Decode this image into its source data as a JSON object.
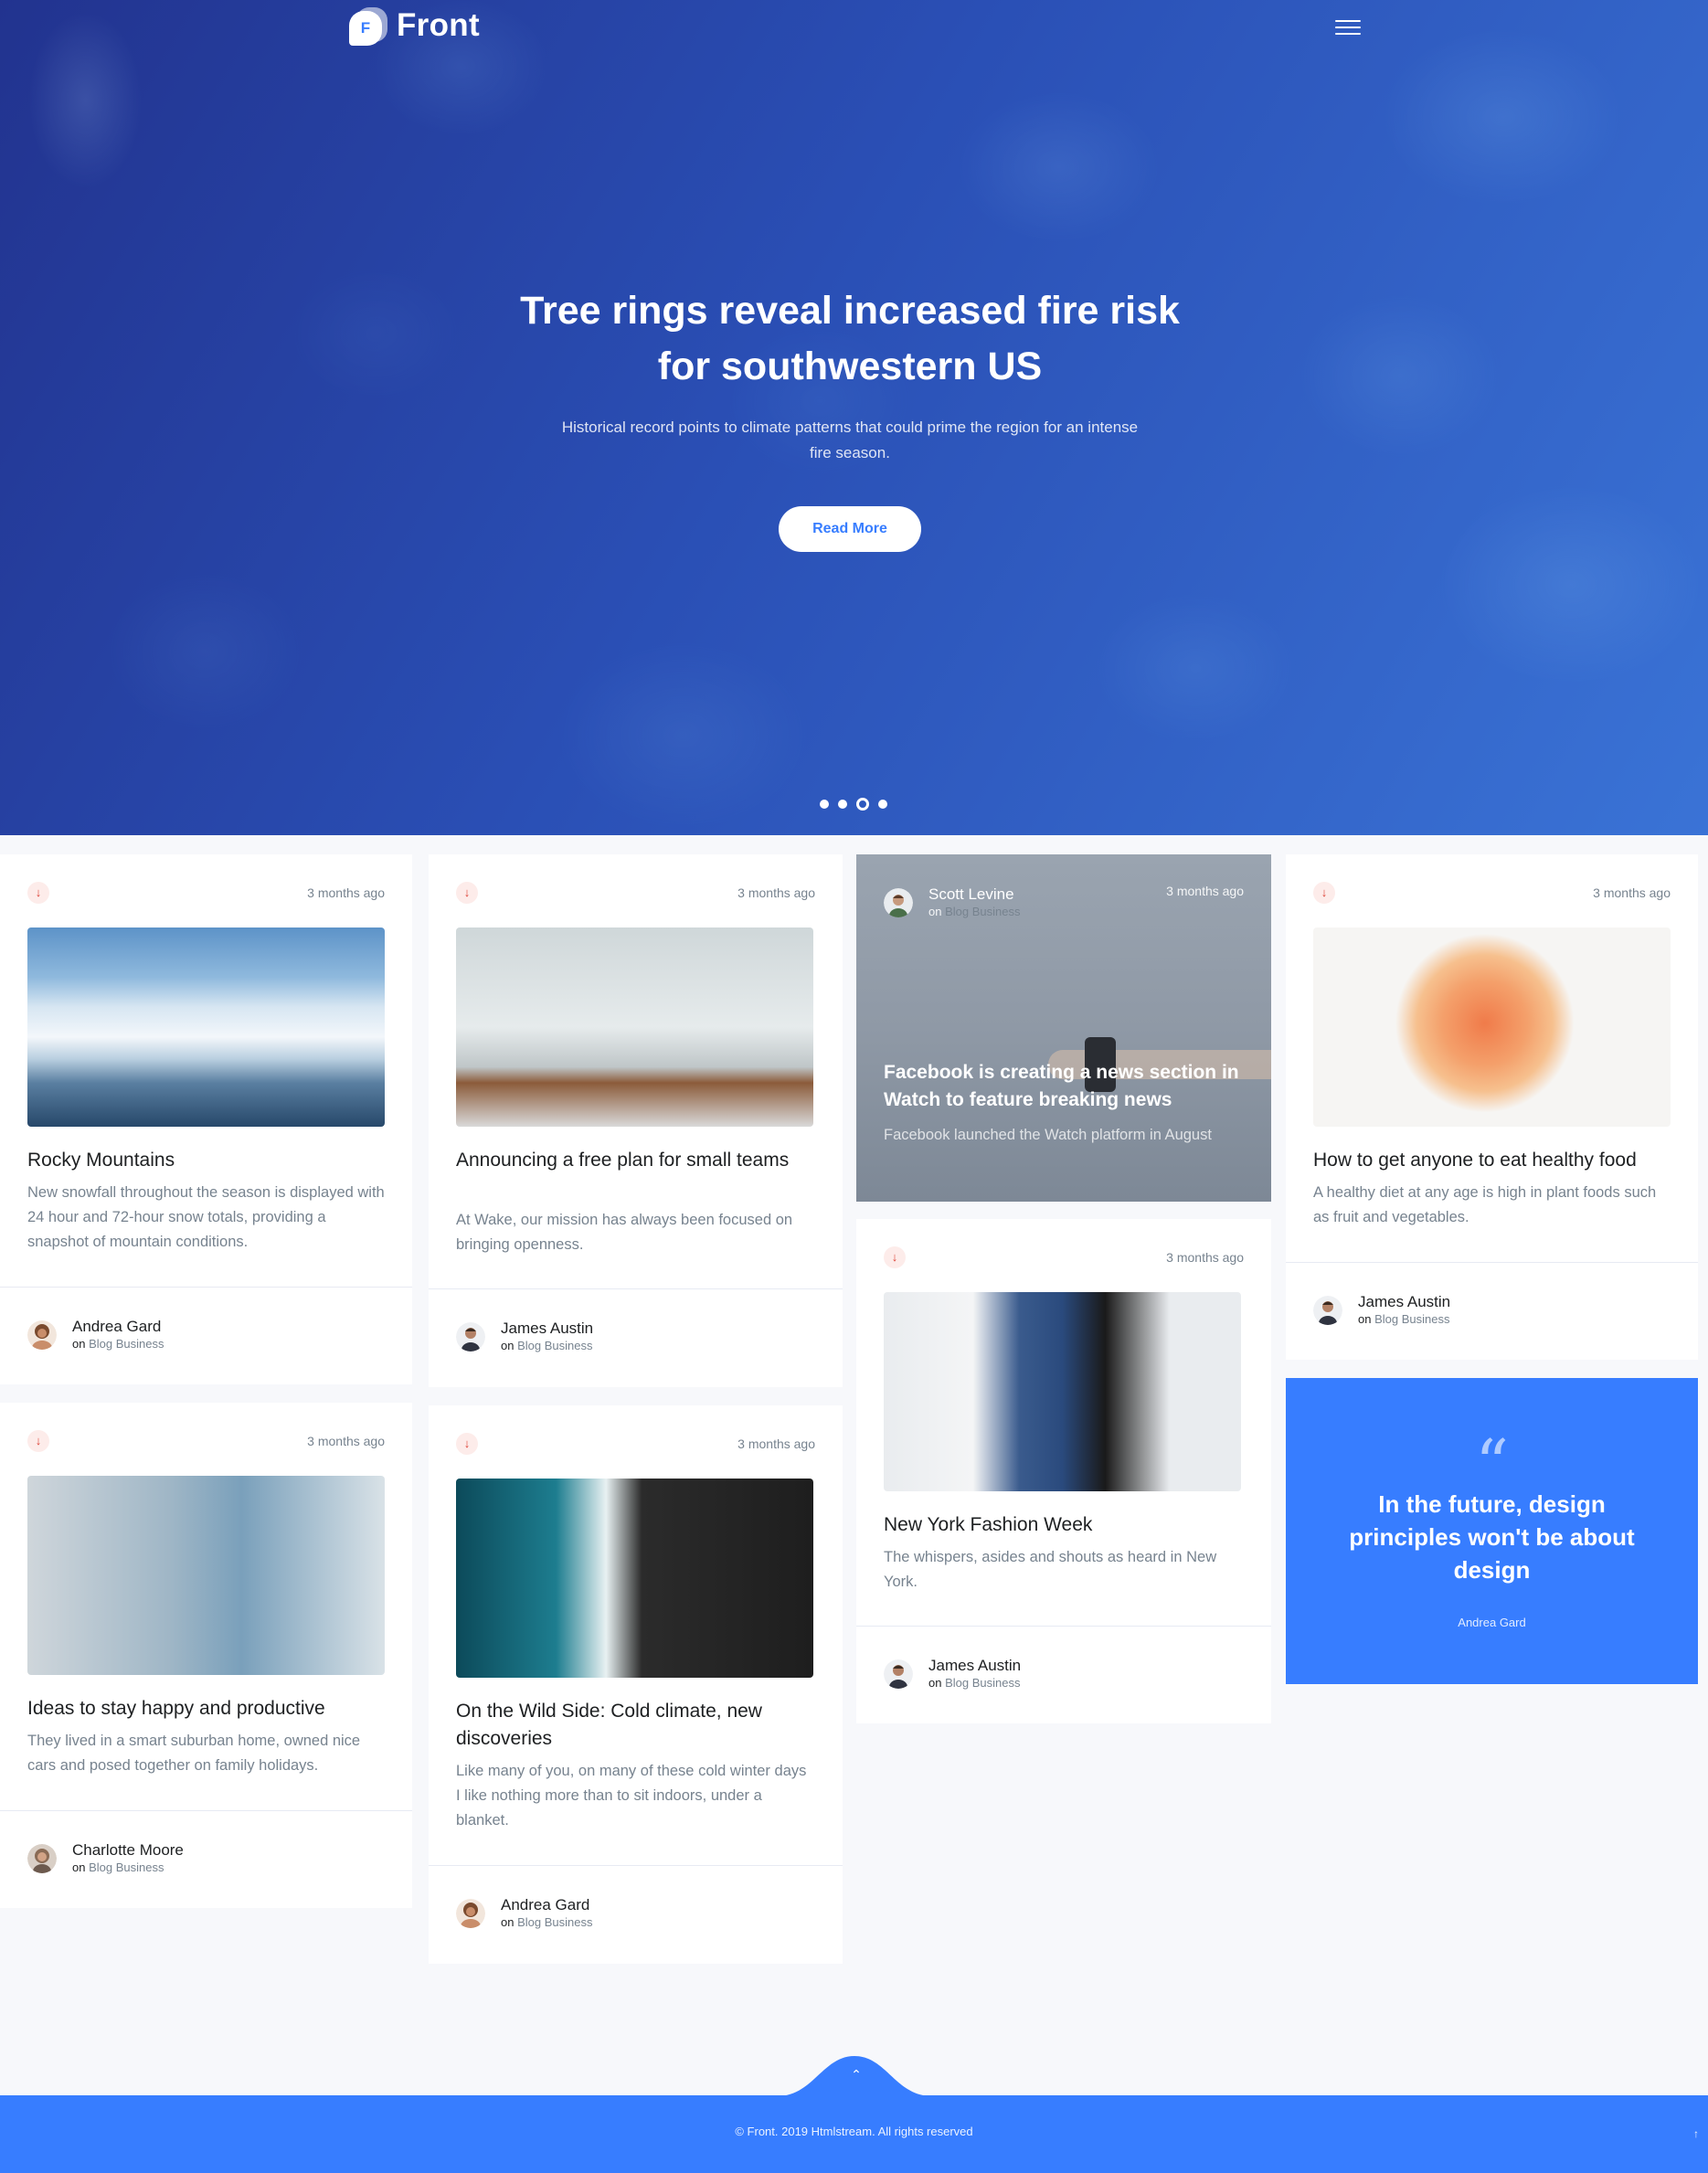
{
  "brand": {
    "name": "Front",
    "logo_letter": "F"
  },
  "hero": {
    "title": "Tree rings reveal increased fire risk for southwestern US",
    "subtitle": "Historical record points to climate patterns that could prime the region for an intense fire season.",
    "button": "Read More",
    "slides": 4,
    "active_slide": 3
  },
  "cards": [
    {
      "time": "3 months ago",
      "title": "Rocky Mountains",
      "desc": "New snowfall throughout the season is displayed with 24 hour and 72-hour snow totals, providing a snapshot of mountain conditions.",
      "author": "Andrea Gard",
      "meta_prefix": "on",
      "meta_category": "Blog Business"
    },
    {
      "time": "3 months ago",
      "title": "Announcing a free plan for small teams",
      "desc": "At Wake, our mission has always been focused on bringing openness.",
      "author": "James Austin",
      "meta_prefix": "on",
      "meta_category": "Blog Business"
    },
    {
      "time": "3 months ago",
      "title": "Ideas to stay happy and productive",
      "desc": "They lived in a smart suburban home, owned nice cars and posed together on family holidays.",
      "author": "Charlotte Moore",
      "meta_prefix": "on",
      "meta_category": "Blog Business"
    },
    {
      "time": "3 months ago",
      "title": "On the Wild Side: Cold climate, new discoveries",
      "desc": "Like many of you, on many of these cold winter days I like nothing more than to sit indoors, under a blanket.",
      "author": "Andrea Gard",
      "meta_prefix": "on",
      "meta_category": "Blog Business"
    },
    {
      "time": "3 months ago",
      "title": "New York Fashion Week",
      "desc": "The whispers, asides and shouts as heard in New York.",
      "author": "James Austin",
      "meta_prefix": "on",
      "meta_category": "Blog Business"
    },
    {
      "time": "3 months ago",
      "title": "How to get anyone to eat healthy food",
      "desc": "A healthy diet at any age is high in plant foods such as fruit and vegetables.",
      "author": "James Austin",
      "meta_prefix": "on",
      "meta_category": "Blog Business"
    }
  ],
  "featured": {
    "author": "Scott Levine",
    "meta_prefix": "on",
    "meta_category": "Blog Business",
    "time": "3 months ago",
    "title": "Facebook is creating a news section in Watch to feature breaking news",
    "desc": "Facebook launched the Watch platform in August"
  },
  "quote": {
    "mark": "“",
    "text": "In the future, design principles won't be about design",
    "author": "Andrea Gard"
  },
  "footer": {
    "copyright": "© Front. 2019 Htmlstream. All rights reserved"
  },
  "colors": {
    "primary": "#377dff",
    "text": "#1e2022",
    "muted": "#77838f",
    "danger": "#de4437"
  }
}
